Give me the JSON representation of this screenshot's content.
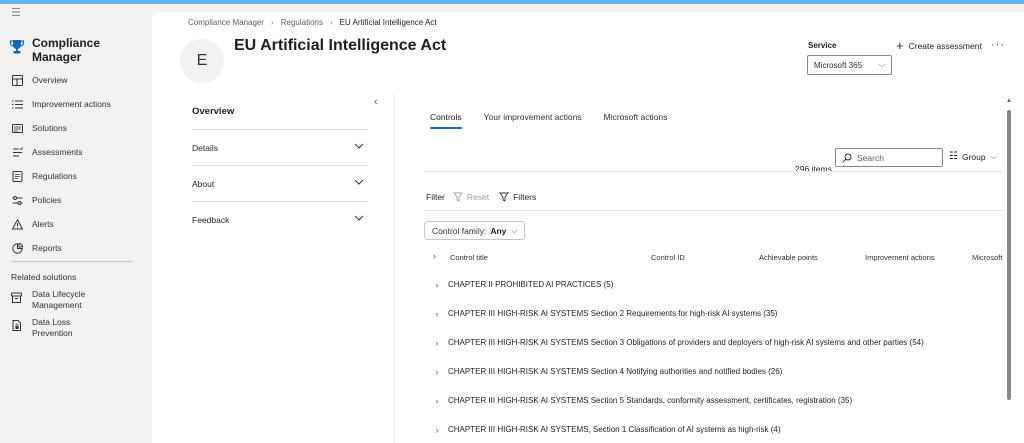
{
  "nav": {
    "brand": "Compliance Manager",
    "items": [
      {
        "label": "Overview",
        "icon": "overview-icon"
      },
      {
        "label": "Improvement actions",
        "icon": "list-icon"
      },
      {
        "label": "Solutions",
        "icon": "solutions-icon"
      },
      {
        "label": "Assessments",
        "icon": "assessments-icon"
      },
      {
        "label": "Regulations",
        "icon": "regulations-icon"
      },
      {
        "label": "Policies",
        "icon": "policies-icon"
      },
      {
        "label": "Alerts",
        "icon": "alert-icon"
      },
      {
        "label": "Reports",
        "icon": "reports-icon"
      }
    ],
    "related_title": "Related solutions",
    "related": [
      {
        "label": "Data Lifecycle Management",
        "icon": "archive-icon"
      },
      {
        "label": "Data Loss Prevention",
        "icon": "dlp-icon"
      }
    ]
  },
  "breadcrumb": [
    "Compliance Manager",
    "Regulations",
    "EU Artificial Intelligence Act"
  ],
  "page": {
    "avatar": "E",
    "title": "EU Artificial Intelligence Act",
    "service_label": "Service",
    "service_value": "Microsoft 365",
    "create_label": "Create assessment",
    "more": "···"
  },
  "details": {
    "items": [
      "Overview",
      "Details",
      "About",
      "Feedback"
    ]
  },
  "tabs": [
    "Controls",
    "Your improvement actions",
    "Microsoft actions"
  ],
  "toolbar": {
    "count": "296 items",
    "search_placeholder": "Search",
    "group_label": "Group"
  },
  "filter": {
    "label": "Filter",
    "reset": "Reset",
    "filters": "Filters",
    "pill_label": "Control family:",
    "pill_value": "Any"
  },
  "table": {
    "headers": [
      "Control title",
      "Control ID",
      "Achievable points",
      "Improvement actions",
      "Microsoft"
    ],
    "rows": [
      "CHAPTER II PROHIBITED AI PRACTICES (5)",
      "CHAPTER III HIGH-RISK AI SYSTEMS Section 2 Requirements for high-risk AI systems (35)",
      "CHAPTER III HIGH-RISK AI SYSTEMS Section 3 Obligations of providers and deployers of high-risk AI systems and other parties (54)",
      "CHAPTER III HIGH-RISK AI SYSTEMS Section 4 Notifying authorities and notified bodies (26)",
      "CHAPTER III HIGH-RISK AI SYSTEMS Section 5 Standards, conformity assessment, certificates, registration (35)",
      "CHAPTER III HIGH-RISK AI SYSTEMS, Section 1 Classification of AI systems as high-risk (4)"
    ]
  },
  "colors": {
    "accent": "#0f6cbd",
    "topbar": "#64b5f6",
    "brand_icon": "#0f6cbd"
  }
}
